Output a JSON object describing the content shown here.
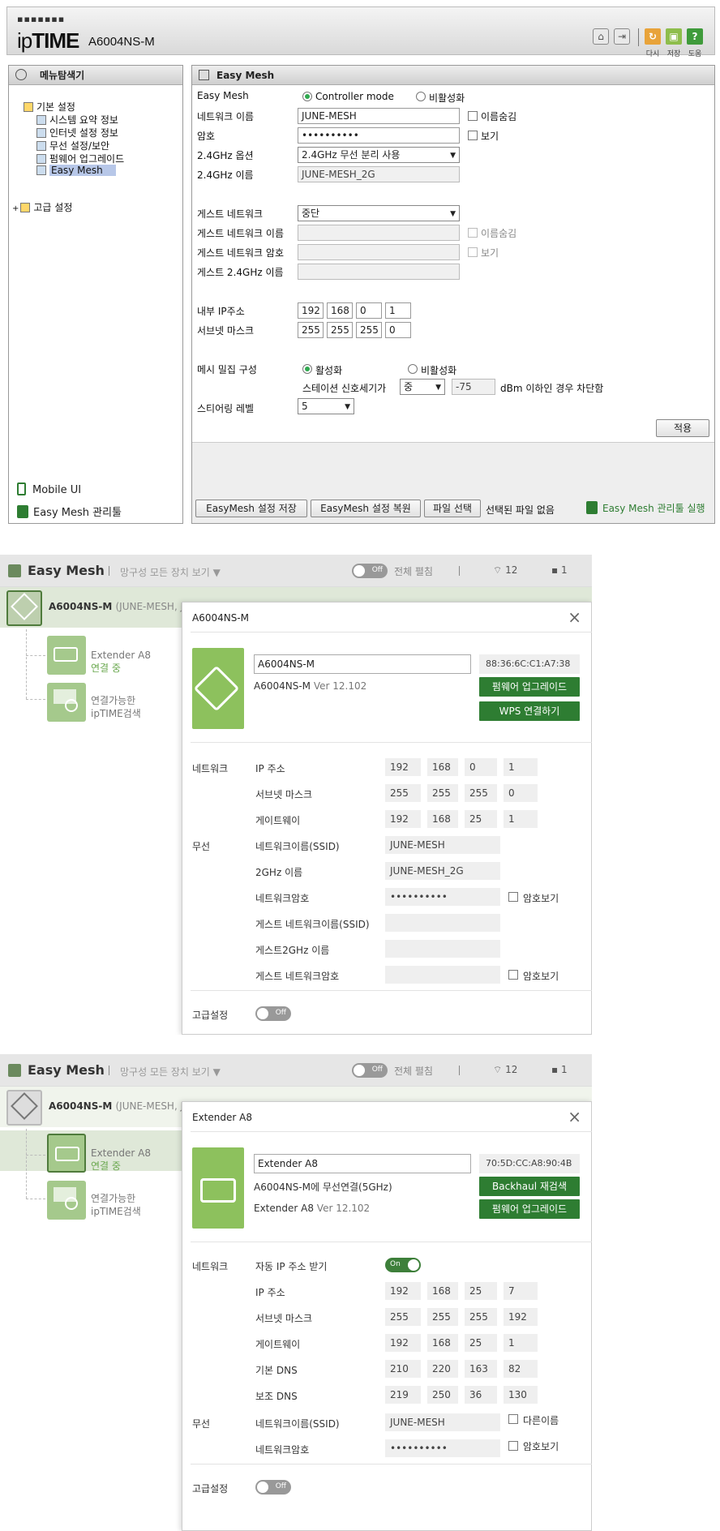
{
  "admin": {
    "logo_dots": "▪▪▪▪▪▪▪",
    "logo_brand_lower": "ip",
    "logo_brand_upper": "TIME",
    "model": "A6004NS-M",
    "header_labels": [
      "다시",
      "저장",
      "도움"
    ],
    "menu_title": "메뉴탐색기",
    "tree": {
      "basic": "기본 설정",
      "items": [
        "시스템 요약 정보",
        "인터넷 설정 정보",
        "무선 설정/보안",
        "펌웨어 업그레이드",
        "Easy Mesh"
      ],
      "advanced": "고급 설정"
    },
    "mobile_ui": "Mobile UI",
    "easymesh_mgr": "Easy Mesh 관리툴",
    "panel_title": "Easy Mesh",
    "form": {
      "easymesh_label": "Easy Mesh",
      "controller_mode": "Controller mode",
      "disable": "비활성화",
      "net_name_label": "네트워크 이름",
      "net_name_value": "JUNE-MESH",
      "hide_name": "이름숨김",
      "password_label": "암호",
      "password_value": "••••••••••",
      "show": "보기",
      "opt24_label": "2.4GHz 옵션",
      "opt24_value": "2.4GHz 무선 분리 사용",
      "name24_label": "2.4GHz 이름",
      "name24_value": "JUNE-MESH_2G",
      "guest_label": "게스트 네트워크",
      "guest_value": "중단",
      "guest_name_label": "게스트 네트워크 이름",
      "guest_pw_label": "게스트 네트워크 암호",
      "guest24_label": "게스트 2.4GHz 이름",
      "ip_label": "내부 IP주소",
      "ip": [
        "192",
        "168",
        "0",
        "1"
      ],
      "mask_label": "서브넷 마스크",
      "mask": [
        "255",
        "255",
        "255",
        "0"
      ],
      "mesh_label": "메시 밀집 구성",
      "enable": "활성화",
      "disable2": "비활성화",
      "station_label": "스테이션 신호세기가",
      "station_value": "중",
      "dbm_value": "-75",
      "dbm_text": "dBm 이하인 경우 차단함",
      "steer_label": "스티어링 레벨",
      "steer_value": "5",
      "apply": "적용"
    },
    "footer": {
      "save": "EasyMesh 설정 저장",
      "restore": "EasyMesh 설정 복원",
      "file_select": "파일 선택",
      "no_file": "선택된 파일 없음",
      "run_tool": "Easy Mesh 관리툴 실행"
    }
  },
  "mesh1": {
    "header_title": "Easy Mesh",
    "filter": "망구성 모든 장치 보기 ▼",
    "toggle_off": "Off",
    "expand_all": "전체 펼침",
    "wifi_count": "12",
    "device_count": "1",
    "root_name": "A6004NS-M",
    "root_sub": "(JUNE-MESH, JU",
    "child_name": "Extender A8",
    "child_status": "연결 중",
    "search_line1": "연결가능한",
    "search_line2": "ipTIME검색",
    "dialog_title": "A6004NS-M",
    "name_value": "A6004NS-M",
    "mac": "88:36:6C:C1:A7:38",
    "model_line": "A6004NS-M",
    "version": "Ver 12.102",
    "btn_fw": "펌웨어 업그레이드",
    "btn_wps": "WPS 연결하기",
    "sec_network": "네트워크",
    "ip_label": "IP 주소",
    "ip": [
      "192",
      "168",
      "0",
      "1"
    ],
    "mask_label": "서브넷 마스크",
    "mask": [
      "255",
      "255",
      "255",
      "0"
    ],
    "gw_label": "게이트웨이",
    "gw": [
      "192",
      "168",
      "25",
      "1"
    ],
    "sec_wireless": "무선",
    "ssid_label": "네트워크이름(SSID)",
    "ssid_value": "JUNE-MESH",
    "name2g_label": "2GHz 이름",
    "name2g_value": "JUNE-MESH_2G",
    "pw_label": "네트워크암호",
    "pw_value": "••••••••••",
    "show_pw": "암호보기",
    "guest_ssid_label": "게스트 네트워크이름(SSID)",
    "guest2g_label": "게스트2GHz 이름",
    "guest_pw_label": "게스트 네트워크암호",
    "adv_label": "고급설정"
  },
  "mesh2": {
    "header_title": "Easy Mesh",
    "filter": "망구성 모든 장치 보기 ▼",
    "toggle_off": "Off",
    "expand_all": "전체 펼침",
    "wifi_count": "12",
    "device_count": "1",
    "root_name": "A6004NS-M",
    "root_sub": "(JUNE-MESH, JU",
    "child_name": "Extender A8",
    "child_status": "연결 중",
    "search_line1": "연결가능한",
    "search_line2": "ipTIME검색",
    "dialog_title": "Extender A8",
    "name_value": "Extender A8",
    "mac": "70:5D:CC:A8:90:4B",
    "conn_line": "A6004NS-M에 무선연결(5GHz)",
    "model_line": "Extender A8",
    "version": "Ver 12.102",
    "btn_backhaul": "Backhaul 재검색",
    "btn_fw": "펌웨어 업그레이드",
    "sec_network": "네트워크",
    "auto_ip_label": "자동 IP 주소 받기",
    "toggle_on": "On",
    "ip_label": "IP 주소",
    "ip": [
      "192",
      "168",
      "25",
      "7"
    ],
    "mask_label": "서브넷 마스크",
    "mask": [
      "255",
      "255",
      "255",
      "192"
    ],
    "gw_label": "게이트웨이",
    "gw": [
      "192",
      "168",
      "25",
      "1"
    ],
    "dns1_label": "기본 DNS",
    "dns1": [
      "210",
      "220",
      "163",
      "82"
    ],
    "dns2_label": "보조 DNS",
    "dns2": [
      "219",
      "250",
      "36",
      "130"
    ],
    "sec_wireless": "무선",
    "ssid_label": "네트워크이름(SSID)",
    "ssid_value": "JUNE-MESH",
    "other_name": "다른이름",
    "pw_label": "네트워크암호",
    "pw_value": "••••••••••",
    "show_pw": "암호보기",
    "adv_label": "고급설정"
  }
}
